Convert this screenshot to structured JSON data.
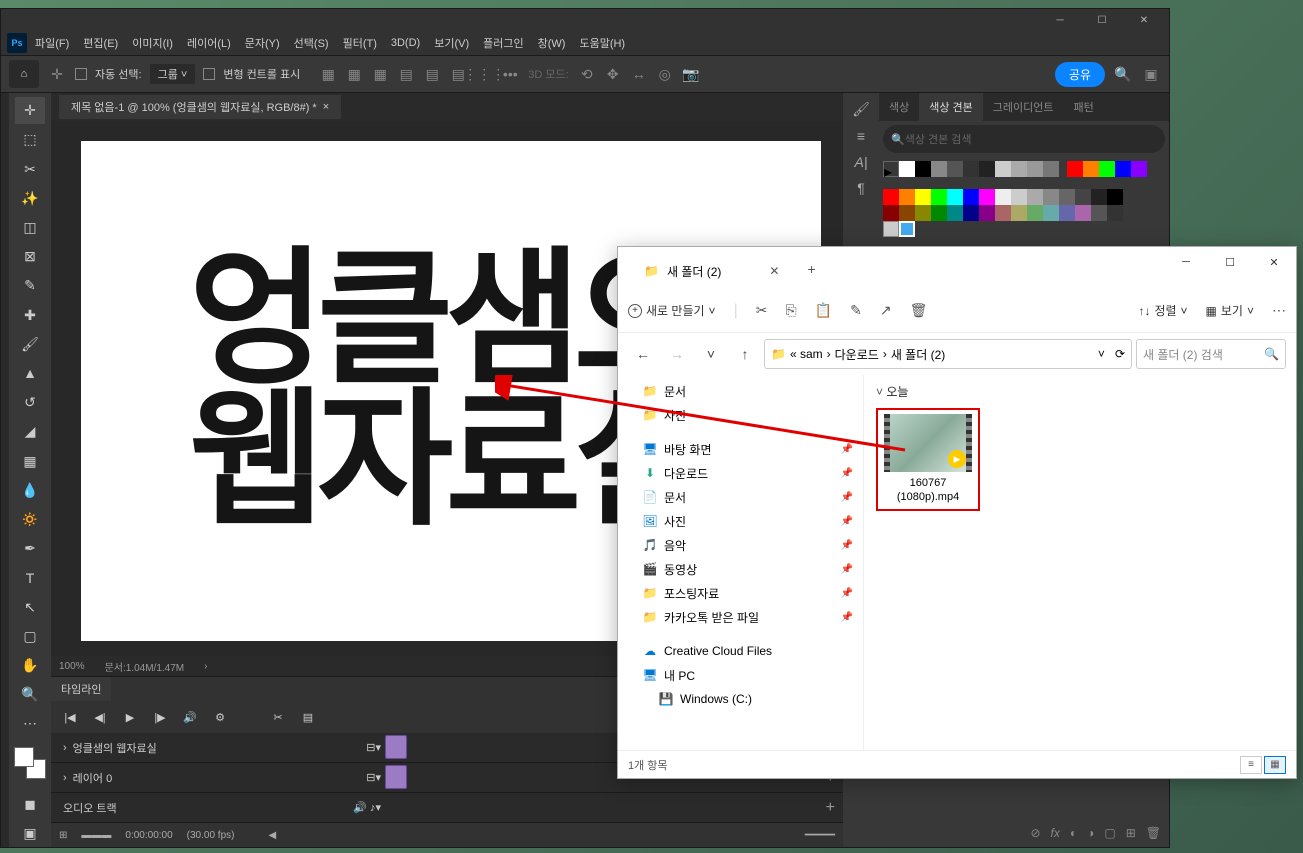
{
  "ps": {
    "menubar": [
      "파일(F)",
      "편집(E)",
      "이미지(I)",
      "레이어(L)",
      "문자(Y)",
      "선택(S)",
      "필터(T)",
      "3D(D)",
      "보기(V)",
      "플러그인",
      "창(W)",
      "도움말(H)"
    ],
    "options": {
      "auto_select_label": "자동 선택:",
      "group": "그룹",
      "transform_controls": "변형 컨트롤 표시",
      "mode_3d": "3D 모드:",
      "share": "공유"
    },
    "tab_title": "제목 없음-1 @ 100% (엉클샘의 웹자료실, RGB/8#) *",
    "canvas_text_1": "엉클샘으",
    "canvas_text_2": "웹자료실",
    "zoom": "100%",
    "docsize": "문서:1.04M/1.47M",
    "timeline_label": "타임라인",
    "tracks": [
      {
        "label": "엉클샘의 웹자료실"
      },
      {
        "label": "레이어 0"
      },
      {
        "label": "오디오 트랙"
      }
    ],
    "playhead": "0:00:00:00",
    "fps": "(30.00 fps)",
    "panel_tabs": [
      "색상",
      "색상 견본",
      "그레이디언트",
      "패턴"
    ],
    "swatch_search": "색상 견본 검색"
  },
  "explorer": {
    "tab_title": "새 폴더 (2)",
    "new_button": "새로 만들기",
    "sort": "정렬",
    "view": "보기",
    "breadcrumb": [
      "« sam",
      "다운로드",
      "새 폴더 (2)"
    ],
    "search_placeholder": "새 폴더 (2) 검색",
    "nav_top": [
      {
        "icon": "📁",
        "label": "문서"
      },
      {
        "icon": "📁",
        "label": "사진"
      }
    ],
    "nav_quick": [
      {
        "icon": "🖥",
        "label": "바탕 화면",
        "pin": true
      },
      {
        "icon": "⬇",
        "label": "다운로드",
        "pin": true
      },
      {
        "icon": "📄",
        "label": "문서",
        "pin": true
      },
      {
        "icon": "🖼",
        "label": "사진",
        "pin": true
      },
      {
        "icon": "🎵",
        "label": "음악",
        "pin": true
      },
      {
        "icon": "🎬",
        "label": "동영상",
        "pin": true
      },
      {
        "icon": "📁",
        "label": "포스팅자료",
        "pin": true
      },
      {
        "icon": "📁",
        "label": "카카오톡 받은 파일",
        "pin": true
      }
    ],
    "nav_bottom": [
      {
        "icon": "☁",
        "label": "Creative Cloud Files"
      },
      {
        "icon": "🖥",
        "label": "내 PC"
      },
      {
        "icon": "💾",
        "label": "Windows (C:)"
      }
    ],
    "group_today": "오늘",
    "file_name_1": "160767",
    "file_name_2": "(1080p).mp4",
    "item_count": "1개 항목"
  }
}
